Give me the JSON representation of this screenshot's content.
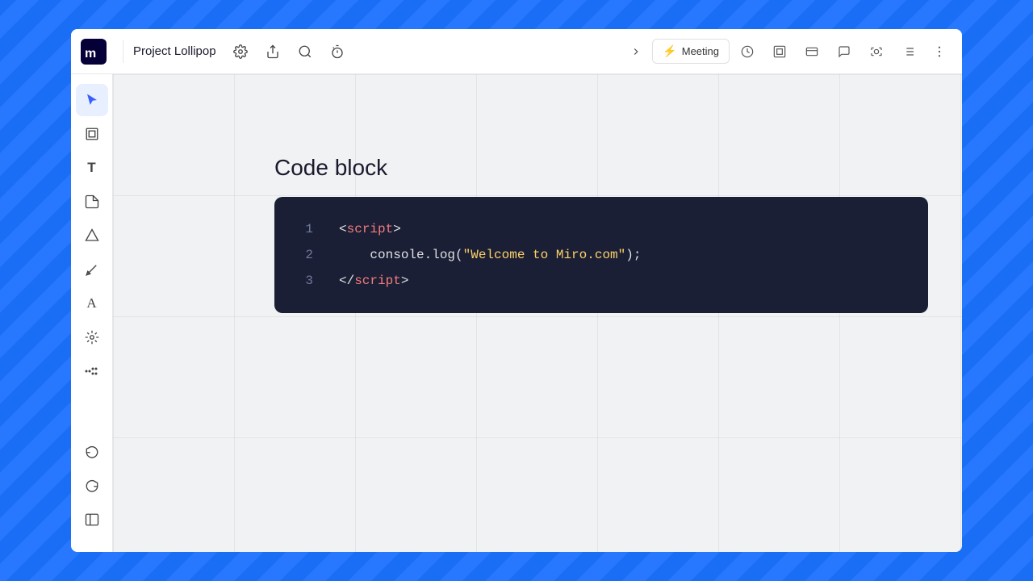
{
  "app": {
    "title": "Project Lollipop",
    "logo": "miro"
  },
  "topbar": {
    "project_name": "Project Lollipop",
    "settings_label": "settings",
    "share_label": "share",
    "search_label": "search",
    "timer_label": "timer",
    "expand_label": "expand panel",
    "meeting_label": "Meeting",
    "right_icons": [
      "timer-icon",
      "frame-icon",
      "card-icon",
      "comment-icon",
      "capture-icon",
      "list-icon"
    ],
    "more_label": "more options"
  },
  "toolbar": {
    "tools": [
      {
        "name": "select",
        "icon": "▲",
        "label": "Select"
      },
      {
        "name": "frames",
        "icon": "⬜",
        "label": "Frames"
      },
      {
        "name": "text",
        "icon": "T",
        "label": "Text"
      },
      {
        "name": "sticky",
        "icon": "◻",
        "label": "Sticky note"
      },
      {
        "name": "shapes",
        "icon": "⬡",
        "label": "Shapes"
      },
      {
        "name": "pen",
        "icon": "✏",
        "label": "Pen"
      },
      {
        "name": "eraser",
        "icon": "A",
        "label": "Text eraser"
      },
      {
        "name": "apps",
        "icon": "⚙",
        "label": "Apps"
      },
      {
        "name": "more-tools",
        "icon": "»",
        "label": "More tools"
      }
    ],
    "undo_label": "Undo",
    "redo_label": "Redo",
    "toggle_panel_label": "Toggle panel"
  },
  "canvas": {
    "section_title": "Code block",
    "code_block": {
      "lines": [
        {
          "number": "1",
          "content": "<script>",
          "parts": [
            {
              "text": "<",
              "color": "default"
            },
            {
              "text": "script",
              "color": "tag"
            },
            {
              "text": ">",
              "color": "default"
            }
          ]
        },
        {
          "number": "2",
          "content": "    console.log(\"Welcome to Miro.com\");",
          "parts": [
            {
              "text": "    console.log(",
              "color": "default"
            },
            {
              "text": "\"Welcome to Miro.com\"",
              "color": "string"
            },
            {
              "text": ");",
              "color": "default"
            }
          ]
        },
        {
          "number": "3",
          "content": "</script>",
          "parts": [
            {
              "text": "</",
              "color": "default"
            },
            {
              "text": "script",
              "color": "tag"
            },
            {
              "text": ">",
              "color": "default"
            }
          ]
        }
      ]
    }
  },
  "colors": {
    "topbar_bg": "#ffffff",
    "canvas_bg": "#f1f2f4",
    "toolbar_bg": "#ffffff",
    "code_bg": "#1a1f36",
    "tag_color": "#f47c7c",
    "string_color": "#ffd166",
    "default_code_color": "#e0e0e0",
    "line_number_color": "#6e7a9a",
    "accent_blue": "#3a5fff"
  }
}
